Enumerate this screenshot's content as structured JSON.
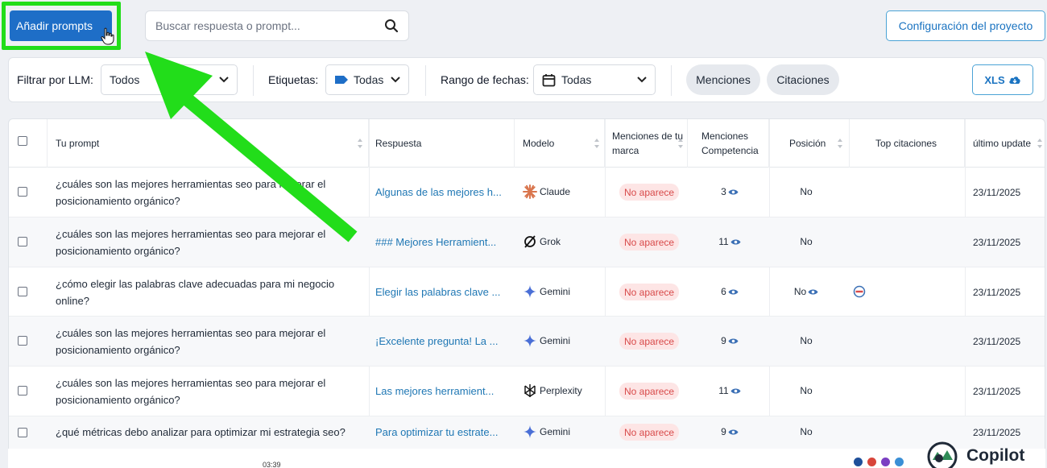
{
  "toolbar": {
    "add_prompts_label": "Añadir prompts",
    "search_placeholder": "Buscar respuesta o prompt...",
    "config_label": "Configuración del proyecto"
  },
  "filters": {
    "llm_label": "Filtrar por LLM:",
    "llm_value": "Todos",
    "tags_label": "Etiquetas:",
    "tags_value": "Todas",
    "date_label": "Rango de fechas:",
    "date_value": "Todas",
    "mentions_label": "Menciones",
    "citations_label": "Citaciones",
    "xls_label": "XLS"
  },
  "table": {
    "headers": {
      "prompt": "Tu prompt",
      "response": "Respuesta",
      "model": "Modelo",
      "brand_mentions_1": "Menciones de tu",
      "brand_mentions_2": "marca",
      "competition_1": "Menciones",
      "competition_2": "Competencia",
      "position": "Posición",
      "top_citations": "Top citaciones",
      "last_update": "último update"
    },
    "rows": [
      {
        "prompt_1": "¿cuáles son las mejores herramientas seo para mejorar el",
        "prompt_2": "posicionamiento orgánico?",
        "response": "Algunas de las mejores h...",
        "model": "Claude",
        "model_icon": "claude-icon",
        "brand": "No aparece",
        "competition": "3",
        "position": "No",
        "date": "23/11/2025"
      },
      {
        "prompt_1": "¿cuáles son las mejores herramientas seo para mejorar el",
        "prompt_2": "posicionamiento orgánico?",
        "response": "### Mejores Herramient...",
        "model": "Grok",
        "model_icon": "grok-icon",
        "brand": "No aparece",
        "competition": "11",
        "position": "No",
        "date": "23/11/2025"
      },
      {
        "prompt_1": "¿cómo elegir las palabras clave adecuadas para mi negocio",
        "prompt_2": "online?",
        "response": "Elegir las palabras clave ...",
        "model": "Gemini",
        "model_icon": "gemini-icon",
        "brand": "No aparece",
        "competition": "6",
        "position": "No",
        "date": "23/11/2025"
      },
      {
        "prompt_1": "¿cuáles son las mejores herramientas seo para mejorar el",
        "prompt_2": "posicionamiento orgánico?",
        "response": "¡Excelente pregunta! La ...",
        "model": "Gemini",
        "model_icon": "gemini-icon",
        "brand": "No aparece",
        "competition": "9",
        "position": "No",
        "date": "23/11/2025"
      },
      {
        "prompt_1": "¿cuáles son las mejores herramientas seo para mejorar el",
        "prompt_2": "posicionamiento orgánico?",
        "response": "Las mejores herramient...",
        "model": "Perplexity",
        "model_icon": "perplexity-icon",
        "brand": "No aparece",
        "competition": "11",
        "position": "No",
        "date": "23/11/2025"
      },
      {
        "prompt_1": "¿qué métricas debo analizar para optimizar mi estrategia seo?",
        "prompt_2": "",
        "response": "Para optimizar tu estrate...",
        "model": "Gemini",
        "model_icon": "gemini-icon",
        "brand": "No aparece",
        "competition": "9",
        "position": "No",
        "date": "23/11/2025"
      }
    ]
  },
  "footer": {
    "timer": "03:39",
    "copilot_label": "Copilot"
  },
  "colors": {
    "primary": "#1e6ec7",
    "highlight": "#22dd1a",
    "badge_bg": "#fde5e5",
    "badge_text": "#d84a4a",
    "link": "#1f77b4"
  }
}
